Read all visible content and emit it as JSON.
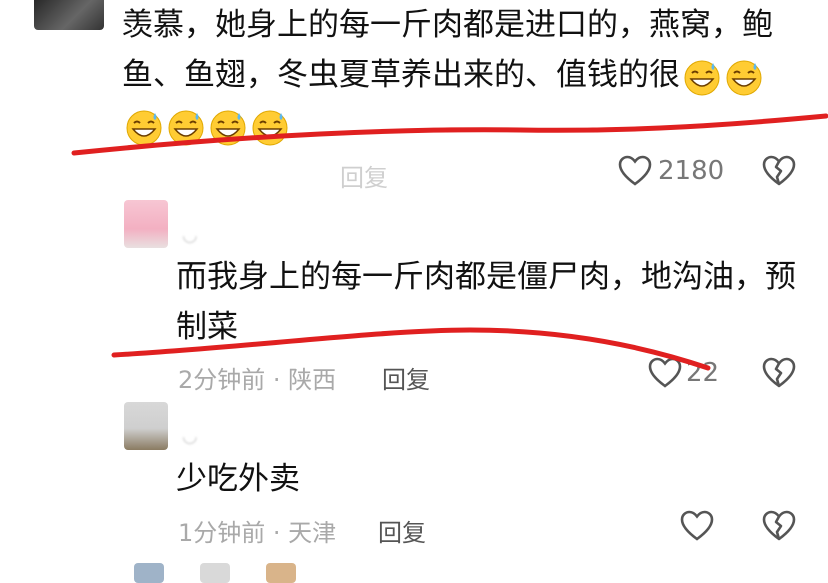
{
  "comments": [
    {
      "text": "羡慕，她身上的每一斤肉都是进口的，燕窝，鲍鱼、鱼翅，冬虫夏草养出来的、值钱的很",
      "emoji_count": 6,
      "emoji_icon": "grinning-sweat-emoji-icon",
      "reply_label": "回复",
      "like_count": "2180"
    },
    {
      "text": "而我身上的每一斤肉都是僵尸肉，地沟油，预制菜",
      "meta": "2分钟前 · 陕西",
      "reply_label": "回复",
      "like_count": "22"
    },
    {
      "text": "少吃外卖",
      "meta": "1分钟前 · 天津",
      "reply_label": "回复",
      "like_count": ""
    }
  ],
  "icons": {
    "like": "heart-outline-icon",
    "dislike": "broken-heart-icon"
  },
  "colors": {
    "annotation_red": "#e02020",
    "meta_gray": "#a9a9a9",
    "text": "#111111"
  }
}
